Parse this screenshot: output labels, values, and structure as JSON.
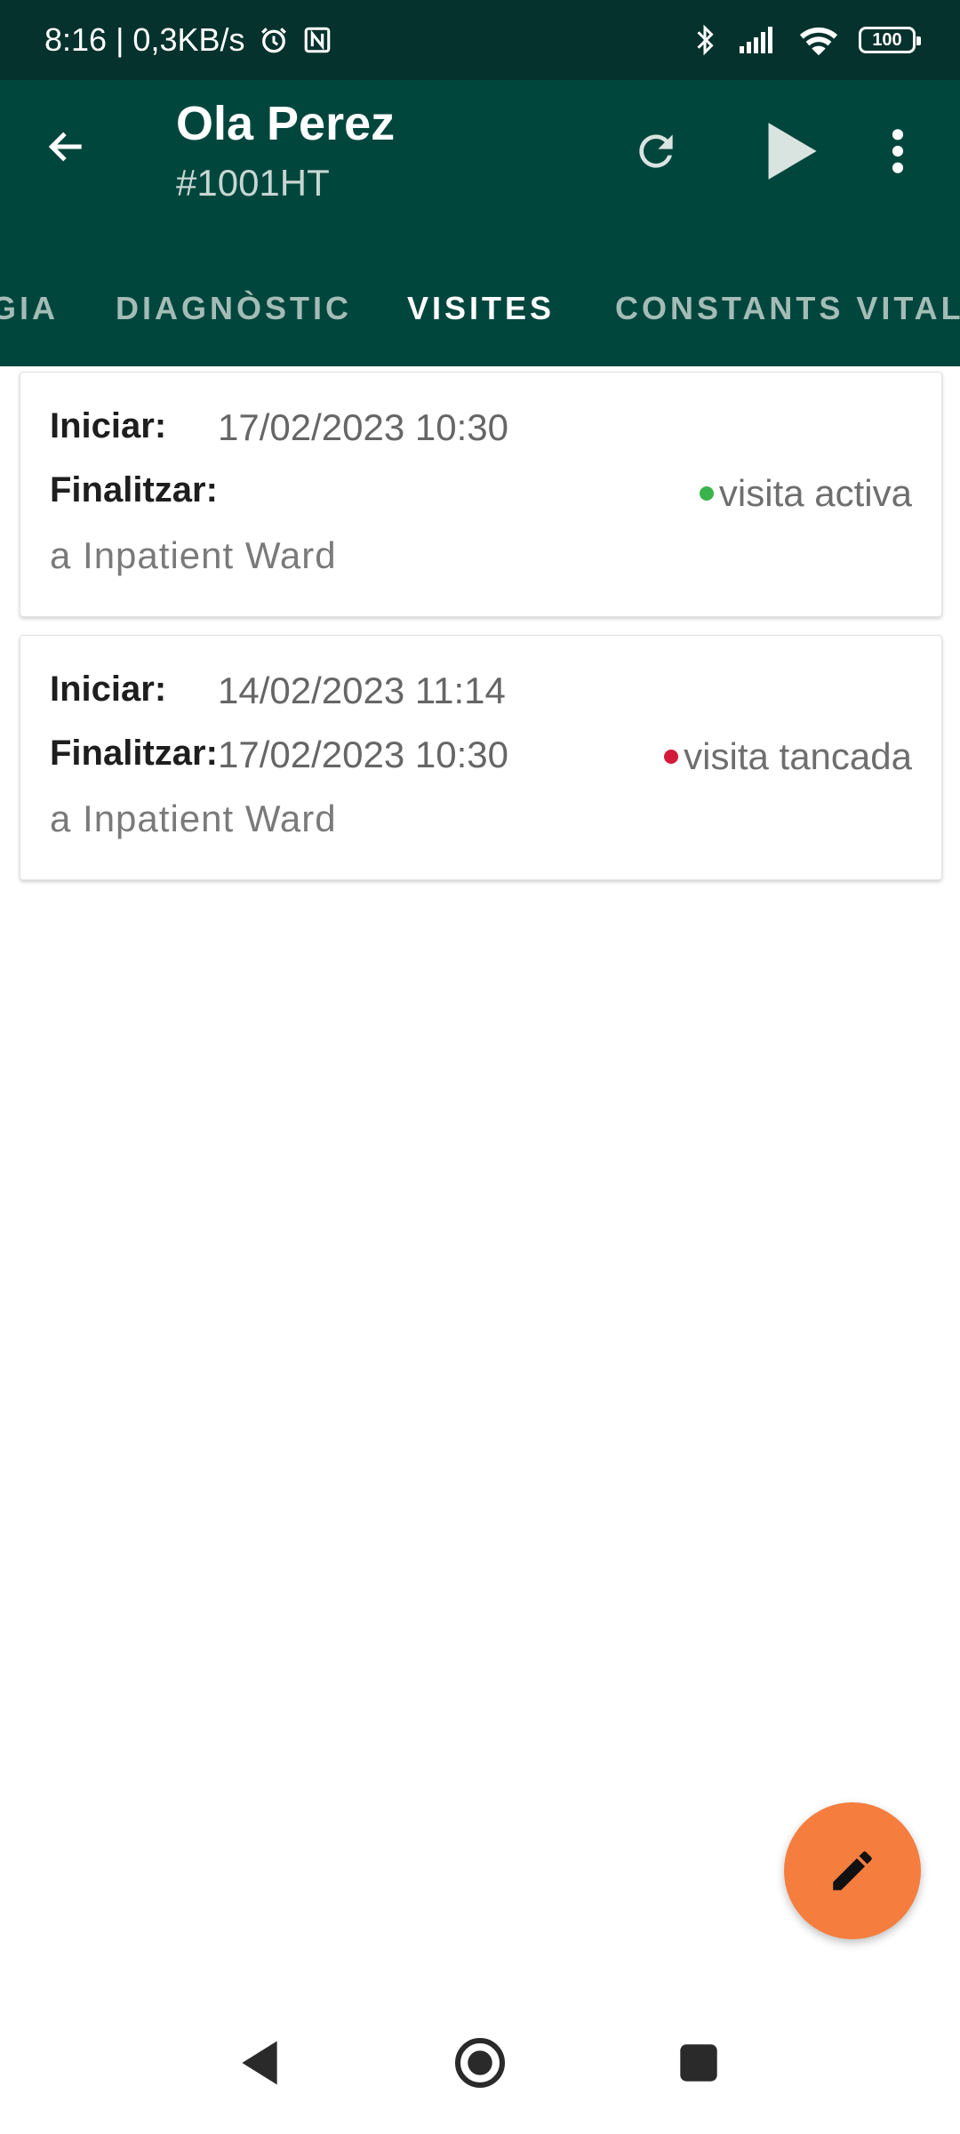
{
  "status_bar": {
    "time_speed": "8:16 | 0,3KB/s",
    "battery": "100",
    "icons": [
      "alarm-icon",
      "nfc-icon",
      "bluetooth-icon",
      "signal-icon",
      "wifi-icon",
      "battery-icon"
    ]
  },
  "app_bar": {
    "title": "Ola Perez",
    "subtitle": "#1001HT",
    "actions": [
      "back-arrow-icon",
      "refresh-icon",
      "play-icon",
      "more-vert-icon"
    ]
  },
  "tabs": [
    {
      "label": "GIA",
      "active": false
    },
    {
      "label": "DIAGNÒSTIC",
      "active": false
    },
    {
      "label": "VISITES",
      "active": true
    },
    {
      "label": "CONSTANTS VITAL",
      "active": false
    }
  ],
  "visits": [
    {
      "start_label": "Iniciar:",
      "start_value": "17/02/2023 10:30",
      "end_label": "Finalitzar:",
      "end_value": "",
      "status": "visita activa",
      "status_color": "#38b44a",
      "location": "a Inpatient Ward"
    },
    {
      "start_label": "Iniciar:",
      "start_value": "14/02/2023 11:14",
      "end_label": "Finalitzar:",
      "end_value": "17/02/2023 10:30",
      "status": "visita tancada",
      "status_color": "#d41a3a",
      "location": "a Inpatient Ward"
    }
  ],
  "fab": {
    "icon": "pencil-icon"
  },
  "colors": {
    "status_bar": "#06322d",
    "app_bar": "#01463d",
    "fab": "#f57d3e"
  }
}
